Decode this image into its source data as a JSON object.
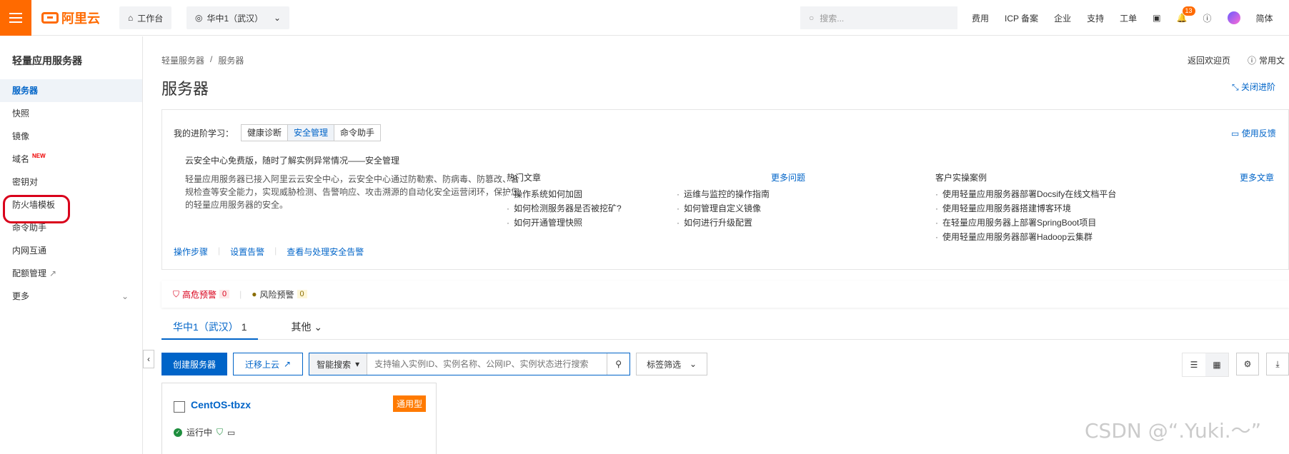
{
  "topbar": {
    "logo_text": "阿里云",
    "workbench": "工作台",
    "region": "华中1（武汉）",
    "search_placeholder": "搜索...",
    "links": [
      "费用",
      "ICP 备案",
      "企业",
      "支持",
      "工单"
    ],
    "notification_count": "13",
    "language": "简体"
  },
  "sidebar": {
    "title": "轻量应用服务器",
    "items": [
      {
        "label": "服务器"
      },
      {
        "label": "快照"
      },
      {
        "label": "镜像"
      },
      {
        "label": "域名",
        "tag": "NEW"
      },
      {
        "label": "密钥对"
      },
      {
        "label": "防火墙模板"
      },
      {
        "label": "命令助手"
      },
      {
        "label": "内网互通"
      },
      {
        "label": "配额管理"
      },
      {
        "label": "更多"
      }
    ]
  },
  "main": {
    "breadcrumb": [
      "轻量服务器",
      "/",
      "服务器"
    ],
    "title": "服务器",
    "back_link": "返回欢迎页",
    "faq_link": "常用文",
    "close_advanced": "关闭进阶",
    "learn": {
      "label": "我的进阶学习：",
      "tabs": [
        "健康诊断",
        "安全管理",
        "命令助手"
      ],
      "feedback": "使用反馈",
      "intro_title": "云安全中心免费版，随时了解实例异常情况——安全管理",
      "intro_body": "轻量应用服务器已接入阿里云云安全中心，云安全中心通过防勒索、防病毒、防篡改、合规检查等安全能力，实现威胁检测、告警响应、攻击溯源的自动化安全运营闭环，保护您的轻量应用服务器的安全。",
      "links": [
        "操作步骤",
        "设置告警",
        "查看与处理安全告警"
      ],
      "hot_title": "热门文章",
      "hot_more": "更多问题",
      "hot_col1": [
        "操作系统如何加固",
        "如何检测服务器是否被挖矿?",
        "如何开通管理快照"
      ],
      "hot_col2": [
        "运维与监控的操作指南",
        "如何管理自定义镜像",
        "如何进行升级配置"
      ],
      "case_title": "客户实操案例",
      "case_more": "更多文章",
      "cases": [
        "使用轻量应用服务器部署Docsify在线文档平台",
        "使用轻量应用服务器搭建博客环境",
        "在轻量应用服务器上部署SpringBoot项目",
        "使用轻量应用服务器部署Hadoop云集群"
      ]
    },
    "alerts": {
      "high_label": "高危预警",
      "high_count": "0",
      "risk_label": "风险预警",
      "risk_count": "0"
    },
    "region_tabs": [
      {
        "label": "华中1（武汉）",
        "count": "1"
      },
      {
        "label": "其他"
      }
    ],
    "toolbar": {
      "create": "创建服务器",
      "migrate": "迁移上云",
      "smart_search": "智能搜索",
      "search_placeholder": "支持输入实例ID、实例名称、公网IP、实例状态进行搜索",
      "tag_filter": "标签筛选"
    },
    "card": {
      "name": "CentOS-tbzx",
      "type": "通用型",
      "status": "运行中"
    }
  },
  "watermark": "CSDN @“.Yuki.～”"
}
